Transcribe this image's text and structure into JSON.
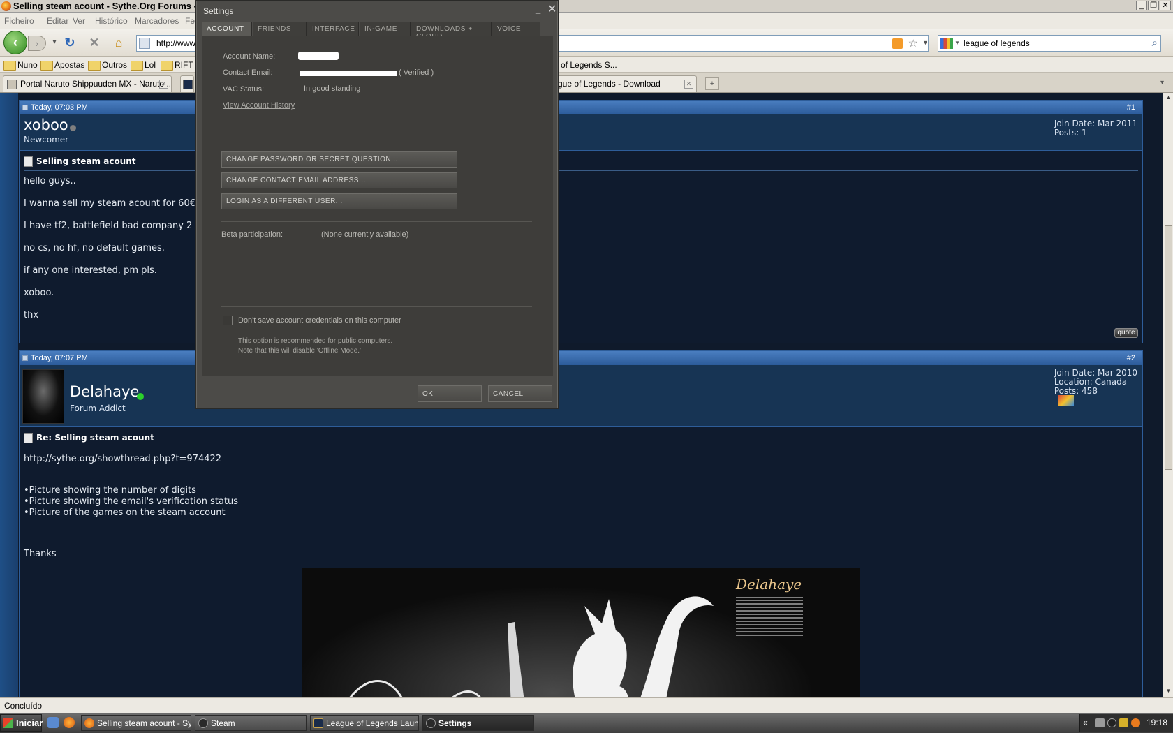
{
  "browser": {
    "title": "Selling steam acount - Sythe.Org Forums - Mo",
    "menu": [
      "Ficheiro",
      "Editar",
      "Ver",
      "Histórico",
      "Marcadores",
      "Fe"
    ],
    "url": "http://www",
    "search_query": "league of legends",
    "bookmarks": [
      "Nuno",
      "Apostas",
      "Outros",
      "Lol",
      "RIFT b",
      "of Legends S..."
    ],
    "tabs": [
      {
        "label": "Portal Naruto Shippuuden MX - Naruto ..."
      },
      {
        "label": "gue of Legends - Download"
      }
    ],
    "status": "Concluído"
  },
  "thread": {
    "posts": [
      {
        "date": "Today, 07:03 PM",
        "number": "#1",
        "username": "xoboo",
        "user_title": "Newcomer",
        "join_date": "Join Date: Mar 2011",
        "posts_count": "Posts: 1",
        "title": "Selling steam acount",
        "lines": [
          "hello guys..",
          "I wanna sell my steam acount for 60€",
          "I have tf2, battlefield bad company 2",
          "no cs, no hf, no default games.",
          "if any one interested, pm pls.",
          "xoboo.",
          "thx"
        ],
        "quote_label": "quote"
      },
      {
        "date": "Today, 07:07 PM",
        "number": "#2",
        "username": "Delahaye",
        "user_title": "Forum Addict",
        "join_date": "Join Date: Mar 2010",
        "location": "Location: Canada",
        "posts_count": "Posts: 458",
        "title": "Re: Selling steam acount",
        "lines": [
          "http://sythe.org/showthread.php?t=974422",
          "•Picture showing the number of digits",
          "•Picture showing the email's verification status",
          "•Picture of the games on the steam account",
          "Thanks"
        ],
        "signature_name": "Delahaye"
      }
    ]
  },
  "settings": {
    "title": "Settings",
    "tabs": [
      "ACCOUNT",
      "FRIENDS",
      "INTERFACE",
      "IN-GAME",
      "DOWNLOADS + CLOUD",
      "VOICE"
    ],
    "active_tab": "ACCOUNT",
    "account_name_label": "Account Name:",
    "contact_email_label": "Contact Email:",
    "verified_text": "( Verified )",
    "vac_label": "VAC Status:",
    "vac_value": "In good standing",
    "history_link": "View Account History",
    "buttons": [
      "CHANGE PASSWORD OR SECRET QUESTION...",
      "CHANGE CONTACT EMAIL ADDRESS...",
      "LOGIN AS A DIFFERENT USER..."
    ],
    "beta_label": "Beta participation:",
    "beta_value": "(None currently available)",
    "checkbox_label": "Don't save account credentials on this computer",
    "note_line1": "This option is recommended for public computers.",
    "note_line2": "Note that this will disable 'Offline Mode.'",
    "ok_label": "OK",
    "cancel_label": "CANCEL"
  },
  "taskbar": {
    "start_label": "Iniciar",
    "tasks": [
      "Selling steam acount - Sy...",
      "Steam",
      "League of Legends Laun...",
      "Settings"
    ],
    "clock": "19:18"
  }
}
